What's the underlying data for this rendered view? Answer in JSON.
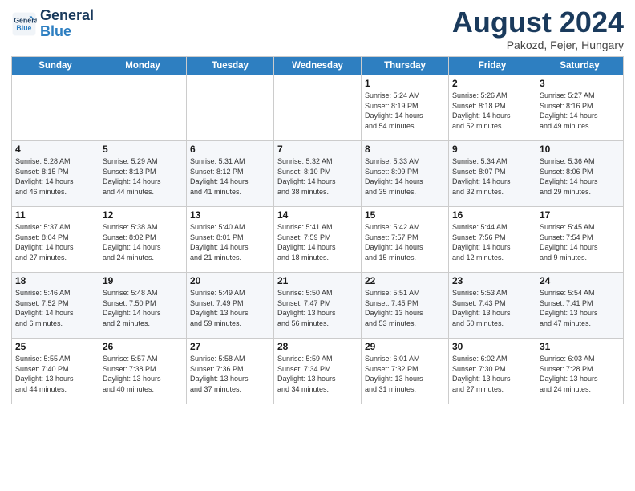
{
  "header": {
    "logo_line1": "General",
    "logo_line2": "Blue",
    "month_year": "August 2024",
    "location": "Pakozd, Fejer, Hungary"
  },
  "weekdays": [
    "Sunday",
    "Monday",
    "Tuesday",
    "Wednesday",
    "Thursday",
    "Friday",
    "Saturday"
  ],
  "weeks": [
    [
      {
        "day": "",
        "detail": ""
      },
      {
        "day": "",
        "detail": ""
      },
      {
        "day": "",
        "detail": ""
      },
      {
        "day": "",
        "detail": ""
      },
      {
        "day": "1",
        "detail": "Sunrise: 5:24 AM\nSunset: 8:19 PM\nDaylight: 14 hours\nand 54 minutes."
      },
      {
        "day": "2",
        "detail": "Sunrise: 5:26 AM\nSunset: 8:18 PM\nDaylight: 14 hours\nand 52 minutes."
      },
      {
        "day": "3",
        "detail": "Sunrise: 5:27 AM\nSunset: 8:16 PM\nDaylight: 14 hours\nand 49 minutes."
      }
    ],
    [
      {
        "day": "4",
        "detail": "Sunrise: 5:28 AM\nSunset: 8:15 PM\nDaylight: 14 hours\nand 46 minutes."
      },
      {
        "day": "5",
        "detail": "Sunrise: 5:29 AM\nSunset: 8:13 PM\nDaylight: 14 hours\nand 44 minutes."
      },
      {
        "day": "6",
        "detail": "Sunrise: 5:31 AM\nSunset: 8:12 PM\nDaylight: 14 hours\nand 41 minutes."
      },
      {
        "day": "7",
        "detail": "Sunrise: 5:32 AM\nSunset: 8:10 PM\nDaylight: 14 hours\nand 38 minutes."
      },
      {
        "day": "8",
        "detail": "Sunrise: 5:33 AM\nSunset: 8:09 PM\nDaylight: 14 hours\nand 35 minutes."
      },
      {
        "day": "9",
        "detail": "Sunrise: 5:34 AM\nSunset: 8:07 PM\nDaylight: 14 hours\nand 32 minutes."
      },
      {
        "day": "10",
        "detail": "Sunrise: 5:36 AM\nSunset: 8:06 PM\nDaylight: 14 hours\nand 29 minutes."
      }
    ],
    [
      {
        "day": "11",
        "detail": "Sunrise: 5:37 AM\nSunset: 8:04 PM\nDaylight: 14 hours\nand 27 minutes."
      },
      {
        "day": "12",
        "detail": "Sunrise: 5:38 AM\nSunset: 8:02 PM\nDaylight: 14 hours\nand 24 minutes."
      },
      {
        "day": "13",
        "detail": "Sunrise: 5:40 AM\nSunset: 8:01 PM\nDaylight: 14 hours\nand 21 minutes."
      },
      {
        "day": "14",
        "detail": "Sunrise: 5:41 AM\nSunset: 7:59 PM\nDaylight: 14 hours\nand 18 minutes."
      },
      {
        "day": "15",
        "detail": "Sunrise: 5:42 AM\nSunset: 7:57 PM\nDaylight: 14 hours\nand 15 minutes."
      },
      {
        "day": "16",
        "detail": "Sunrise: 5:44 AM\nSunset: 7:56 PM\nDaylight: 14 hours\nand 12 minutes."
      },
      {
        "day": "17",
        "detail": "Sunrise: 5:45 AM\nSunset: 7:54 PM\nDaylight: 14 hours\nand 9 minutes."
      }
    ],
    [
      {
        "day": "18",
        "detail": "Sunrise: 5:46 AM\nSunset: 7:52 PM\nDaylight: 14 hours\nand 6 minutes."
      },
      {
        "day": "19",
        "detail": "Sunrise: 5:48 AM\nSunset: 7:50 PM\nDaylight: 14 hours\nand 2 minutes."
      },
      {
        "day": "20",
        "detail": "Sunrise: 5:49 AM\nSunset: 7:49 PM\nDaylight: 13 hours\nand 59 minutes."
      },
      {
        "day": "21",
        "detail": "Sunrise: 5:50 AM\nSunset: 7:47 PM\nDaylight: 13 hours\nand 56 minutes."
      },
      {
        "day": "22",
        "detail": "Sunrise: 5:51 AM\nSunset: 7:45 PM\nDaylight: 13 hours\nand 53 minutes."
      },
      {
        "day": "23",
        "detail": "Sunrise: 5:53 AM\nSunset: 7:43 PM\nDaylight: 13 hours\nand 50 minutes."
      },
      {
        "day": "24",
        "detail": "Sunrise: 5:54 AM\nSunset: 7:41 PM\nDaylight: 13 hours\nand 47 minutes."
      }
    ],
    [
      {
        "day": "25",
        "detail": "Sunrise: 5:55 AM\nSunset: 7:40 PM\nDaylight: 13 hours\nand 44 minutes."
      },
      {
        "day": "26",
        "detail": "Sunrise: 5:57 AM\nSunset: 7:38 PM\nDaylight: 13 hours\nand 40 minutes."
      },
      {
        "day": "27",
        "detail": "Sunrise: 5:58 AM\nSunset: 7:36 PM\nDaylight: 13 hours\nand 37 minutes."
      },
      {
        "day": "28",
        "detail": "Sunrise: 5:59 AM\nSunset: 7:34 PM\nDaylight: 13 hours\nand 34 minutes."
      },
      {
        "day": "29",
        "detail": "Sunrise: 6:01 AM\nSunset: 7:32 PM\nDaylight: 13 hours\nand 31 minutes."
      },
      {
        "day": "30",
        "detail": "Sunrise: 6:02 AM\nSunset: 7:30 PM\nDaylight: 13 hours\nand 27 minutes."
      },
      {
        "day": "31",
        "detail": "Sunrise: 6:03 AM\nSunset: 7:28 PM\nDaylight: 13 hours\nand 24 minutes."
      }
    ]
  ]
}
